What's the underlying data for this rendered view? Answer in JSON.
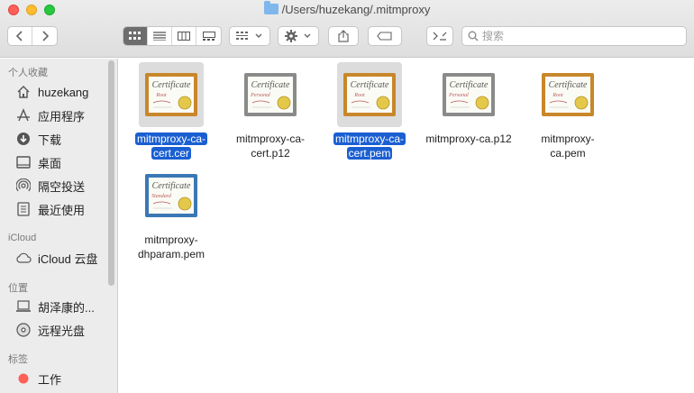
{
  "window": {
    "path": "/Users/huzekang/.mitmproxy"
  },
  "toolbar": {
    "back_icon": "chevron-left-icon",
    "forward_icon": "chevron-right-icon",
    "view_modes": [
      "icon-view",
      "list-view",
      "column-view",
      "gallery-view"
    ],
    "active_view": 0,
    "search_placeholder": "搜索"
  },
  "sidebar": {
    "favorites_header": "个人收藏",
    "favorites": [
      {
        "label": "huzekang",
        "icon": "home-icon"
      },
      {
        "label": "应用程序",
        "icon": "applications-icon"
      },
      {
        "label": "下载",
        "icon": "download-icon"
      },
      {
        "label": "桌面",
        "icon": "desktop-icon"
      },
      {
        "label": "隔空投送",
        "icon": "airdrop-icon"
      },
      {
        "label": "最近使用",
        "icon": "recents-icon"
      }
    ],
    "icloud_header": "iCloud",
    "icloud": [
      {
        "label": "iCloud 云盘",
        "icon": "cloud-icon"
      }
    ],
    "locations_header": "位置",
    "locations": [
      {
        "label": "胡泽康的...",
        "icon": "laptop-icon"
      },
      {
        "label": "远程光盘",
        "icon": "disc-icon"
      }
    ],
    "tags_header": "标签",
    "tags": [
      {
        "label": "工作",
        "color": "#fe5f57"
      }
    ]
  },
  "files": [
    {
      "line1": "mitmproxy-ca-",
      "line2": "cert.cer",
      "kind": "root",
      "selected": true
    },
    {
      "line1": "mitmproxy-ca-",
      "line2": "cert.p12",
      "kind": "personal",
      "selected": false
    },
    {
      "line1": "mitmproxy-ca-",
      "line2": "cert.pem",
      "kind": "root",
      "selected": true
    },
    {
      "line1": "mitmproxy-ca.p12",
      "line2": "",
      "kind": "personal",
      "selected": false
    },
    {
      "line1": "mitmproxy-",
      "line2": "ca.pem",
      "kind": "root",
      "selected": false
    },
    {
      "line1": "mitmproxy-",
      "line2": "dhparam.pem",
      "kind": "standard",
      "selected": false
    }
  ],
  "cert_text": {
    "title": "Certificate",
    "root": "Root",
    "personal": "Personal",
    "standard": "Standard"
  },
  "colors": {
    "selection": "#1a5fd2",
    "root_frame": "#c8872a",
    "personal_frame": "#8a8a8a",
    "standard_frame": "#3a78b5"
  }
}
